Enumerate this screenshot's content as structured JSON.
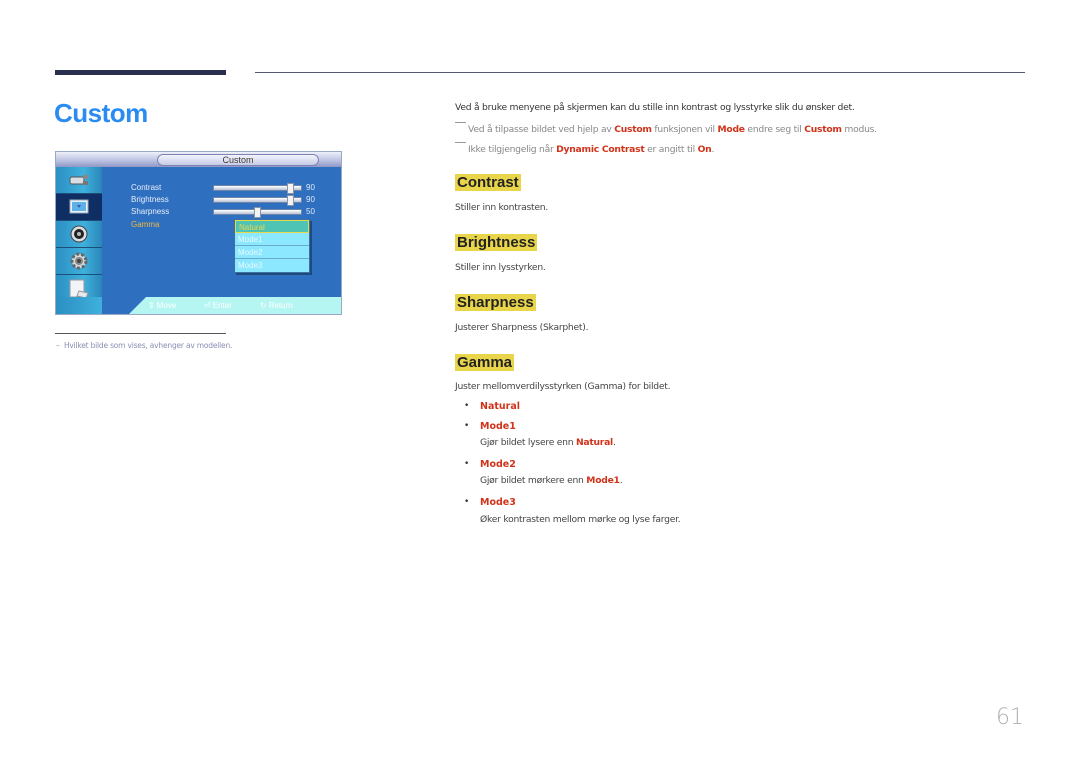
{
  "page": {
    "title": "Custom",
    "page_number": "61",
    "accent_color": "#2a8cf3",
    "highlight_color": "#d0331a",
    "heading_bg_color": "#e9d54a"
  },
  "osd": {
    "title": "Custom",
    "side_icons": [
      "input-icon",
      "picture-icon",
      "sound-icon",
      "setup-icon",
      "multi-control-icon"
    ],
    "items": [
      {
        "label": "Contrast",
        "value": "90"
      },
      {
        "label": "Brightness",
        "value": "90"
      },
      {
        "label": "Sharpness",
        "value": "50"
      },
      {
        "label": "Gamma",
        "value": ""
      }
    ],
    "gamma_options": [
      "Natural",
      "Mode1",
      "Mode2",
      "Mode3"
    ],
    "gamma_selected": "Natural",
    "footer": {
      "move": "Move",
      "enter": "Enter",
      "return": "Return"
    }
  },
  "footnote": {
    "dash": "–",
    "text": "Hvilket bilde som vises, avhenger av modellen."
  },
  "intro": "Ved å bruke menyene på skjermen kan du stille inn kontrast og lysstyrke slik du ønsker det.",
  "notes": [
    {
      "p1": "Ved å tilpasse bildet ved hjelp av ",
      "h1": "Custom",
      "p2": " funksjonen vil ",
      "h2": "Mode",
      "p3": " endre seg til ",
      "h3": "Custom",
      "p4": " modus."
    },
    {
      "p1": "Ikke tilgjengelig når ",
      "h1": "Dynamic Contrast",
      "p2": " er angitt til ",
      "h2": "On",
      "p3": "."
    }
  ],
  "sections": [
    {
      "heading": "Contrast",
      "desc": "Stiller inn kontrasten."
    },
    {
      "heading": "Brightness",
      "desc": "Stiller inn lysstyrken."
    },
    {
      "heading": "Sharpness",
      "desc": "Justerer Sharpness (Skarphet)."
    },
    {
      "heading": "Gamma",
      "desc": "Juster mellomverdilysstyrken (Gamma) for bildet."
    }
  ],
  "gamma_list": [
    {
      "bullet": "•",
      "label": "Natural"
    },
    {
      "bullet": "•",
      "label": "Mode1",
      "desc_pre": "Gjør bildet lysere enn ",
      "desc_hl": "Natural",
      "desc_post": "."
    },
    {
      "bullet": "•",
      "label": "Mode2",
      "desc_pre": "Gjør bildet mørkere enn ",
      "desc_hl": "Mode1",
      "desc_post": "."
    },
    {
      "bullet": "•",
      "label": "Mode3",
      "desc": "Øker kontrasten mellom mørke og lyse farger."
    }
  ]
}
